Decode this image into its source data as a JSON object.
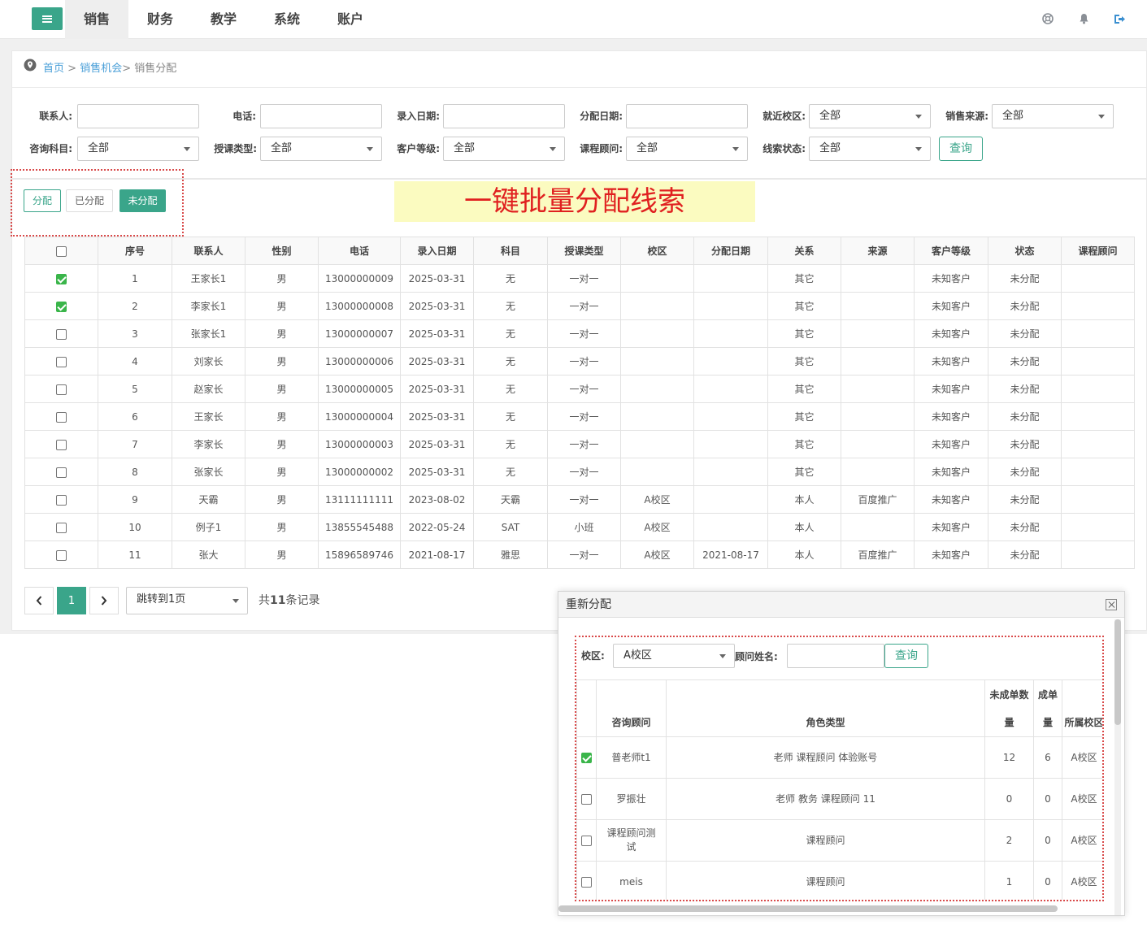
{
  "nav": {
    "menu_icon": "hamburger-icon",
    "items": [
      "销售",
      "财务",
      "教学",
      "系统",
      "账户"
    ],
    "active_index": 0,
    "right_icons": [
      "help-ring-icon",
      "bell-icon",
      "logout-icon"
    ]
  },
  "breadcrumb": {
    "icon": "location-pin-icon",
    "home": "首页",
    "sep1": " > ",
    "parent": "销售机会",
    "current": "> 销售分配"
  },
  "filters": {
    "contact_label": "联系人:",
    "phone_label": "电话:",
    "entry_date_label": "录入日期:",
    "assign_date_label": "分配日期:",
    "campus_label": "就近校区:",
    "campus_value": "全部",
    "source_label": "销售来源:",
    "source_value": "全部",
    "subject_label": "咨询科目:",
    "subject_value": "全部",
    "class_type_label": "授课类型:",
    "class_type_value": "全部",
    "level_label": "客户等级:",
    "level_value": "全部",
    "advisor_label": "课程顾问:",
    "advisor_value": "全部",
    "lead_status_label": "线索状态:",
    "lead_status_value": "全部",
    "query_button": "查询"
  },
  "tabs": {
    "assign": "分配",
    "assigned": "已分配",
    "unassigned": "未分配"
  },
  "banner": "一键批量分配线索",
  "table": {
    "headers": [
      "序号",
      "联系人",
      "性别",
      "电话",
      "录入日期",
      "科目",
      "授课类型",
      "校区",
      "分配日期",
      "关系",
      "来源",
      "客户等级",
      "状态",
      "课程顾问"
    ],
    "rows": [
      {
        "checked": true,
        "cells": [
          "1",
          "王家长1",
          "男",
          "13000000009",
          "2025-03-31",
          "无",
          "一对一",
          "",
          "",
          "其它",
          "",
          "未知客户",
          "未分配",
          ""
        ]
      },
      {
        "checked": true,
        "cells": [
          "2",
          "李家长1",
          "男",
          "13000000008",
          "2025-03-31",
          "无",
          "一对一",
          "",
          "",
          "其它",
          "",
          "未知客户",
          "未分配",
          ""
        ]
      },
      {
        "checked": false,
        "cells": [
          "3",
          "张家长1",
          "男",
          "13000000007",
          "2025-03-31",
          "无",
          "一对一",
          "",
          "",
          "其它",
          "",
          "未知客户",
          "未分配",
          ""
        ]
      },
      {
        "checked": false,
        "cells": [
          "4",
          "刘家长",
          "男",
          "13000000006",
          "2025-03-31",
          "无",
          "一对一",
          "",
          "",
          "其它",
          "",
          "未知客户",
          "未分配",
          ""
        ]
      },
      {
        "checked": false,
        "cells": [
          "5",
          "赵家长",
          "男",
          "13000000005",
          "2025-03-31",
          "无",
          "一对一",
          "",
          "",
          "其它",
          "",
          "未知客户",
          "未分配",
          ""
        ]
      },
      {
        "checked": false,
        "cells": [
          "6",
          "王家长",
          "男",
          "13000000004",
          "2025-03-31",
          "无",
          "一对一",
          "",
          "",
          "其它",
          "",
          "未知客户",
          "未分配",
          ""
        ]
      },
      {
        "checked": false,
        "cells": [
          "7",
          "李家长",
          "男",
          "13000000003",
          "2025-03-31",
          "无",
          "一对一",
          "",
          "",
          "其它",
          "",
          "未知客户",
          "未分配",
          ""
        ]
      },
      {
        "checked": false,
        "cells": [
          "8",
          "张家长",
          "男",
          "13000000002",
          "2025-03-31",
          "无",
          "一对一",
          "",
          "",
          "其它",
          "",
          "未知客户",
          "未分配",
          ""
        ]
      },
      {
        "checked": false,
        "cells": [
          "9",
          "天霸",
          "男",
          "13111111111",
          "2023-08-02",
          "天霸",
          "一对一",
          "A校区",
          "",
          "本人",
          "百度推广",
          "未知客户",
          "未分配",
          ""
        ]
      },
      {
        "checked": false,
        "cells": [
          "10",
          "例子1",
          "男",
          "13855545488",
          "2022-05-24",
          "SAT",
          "小班",
          "A校区",
          "",
          "本人",
          "",
          "未知客户",
          "未分配",
          ""
        ]
      },
      {
        "checked": false,
        "cells": [
          "11",
          "张大",
          "男",
          "15896589746",
          "2021-08-17",
          "雅思",
          "一对一",
          "A校区",
          "2021-08-17",
          "本人",
          "百度推广",
          "未知客户",
          "未分配",
          ""
        ]
      }
    ]
  },
  "pager": {
    "prev_icon": "chevron-left-icon",
    "next_icon": "chevron-right-icon",
    "current_page": "1",
    "jump_value": "跳转到1页",
    "total_prefix": "共",
    "total_count": "11",
    "total_suffix": "条记录"
  },
  "modal": {
    "title": "重新分配",
    "close_icon": "close-icon",
    "campus_label": "校区:",
    "campus_value": "A校区",
    "name_label": "顾问姓名:",
    "query_button": "查询",
    "headers": [
      "咨询顾问",
      "角色类型",
      "未成单数量",
      "成单量",
      "所属校区"
    ],
    "rows": [
      {
        "checked": true,
        "cells": [
          "普老师t1",
          "老师 课程顾问 体验账号",
          "12",
          "6",
          "A校区"
        ]
      },
      {
        "checked": false,
        "cells": [
          "罗振壮",
          "老师 教务 课程顾问 11",
          "0",
          "0",
          "A校区"
        ]
      },
      {
        "checked": false,
        "cells": [
          "课程顾问测试",
          "课程顾问",
          "2",
          "0",
          "A校区"
        ]
      },
      {
        "checked": false,
        "cells": [
          "meis",
          "课程顾问",
          "1",
          "0",
          "A校区"
        ]
      }
    ]
  },
  "colors": {
    "accent": "#3aa58a",
    "highlight_red": "#e02020",
    "banner_bg": "#fbfbc0",
    "dotted_border": "#d94a4a"
  }
}
